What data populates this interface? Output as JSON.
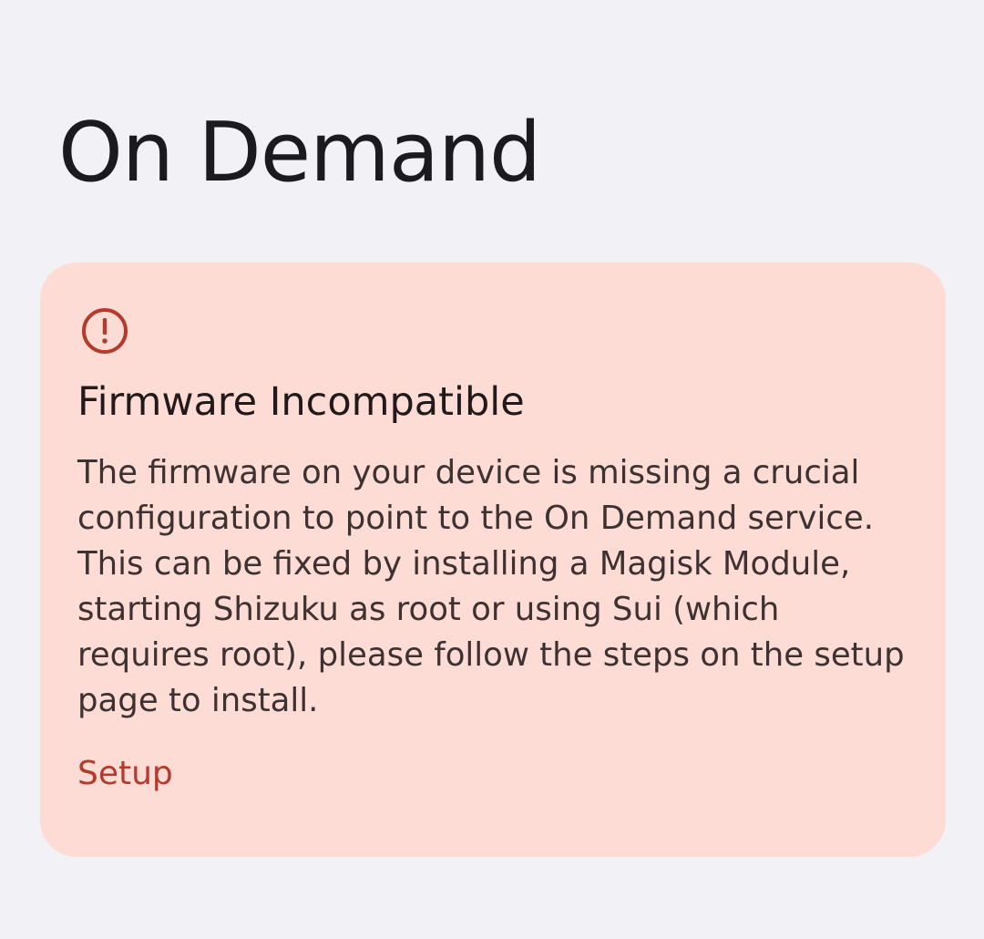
{
  "page": {
    "title": "On Demand"
  },
  "warning_card": {
    "icon": "error-outline-icon",
    "title": "Firmware Incompatible",
    "message": "The firmware on your device is missing a crucial configuration to point to the On Demand service. This can be fixed by installing a Magisk Module, starting Shizuku as root or using Sui (which requires root), please follow the steps on the setup page to install.",
    "action_label": "Setup"
  },
  "colors": {
    "background": "#f2f1f5",
    "card_background": "#fedcd6",
    "accent": "#b43a2c",
    "title_text": "#1b1a1f"
  }
}
